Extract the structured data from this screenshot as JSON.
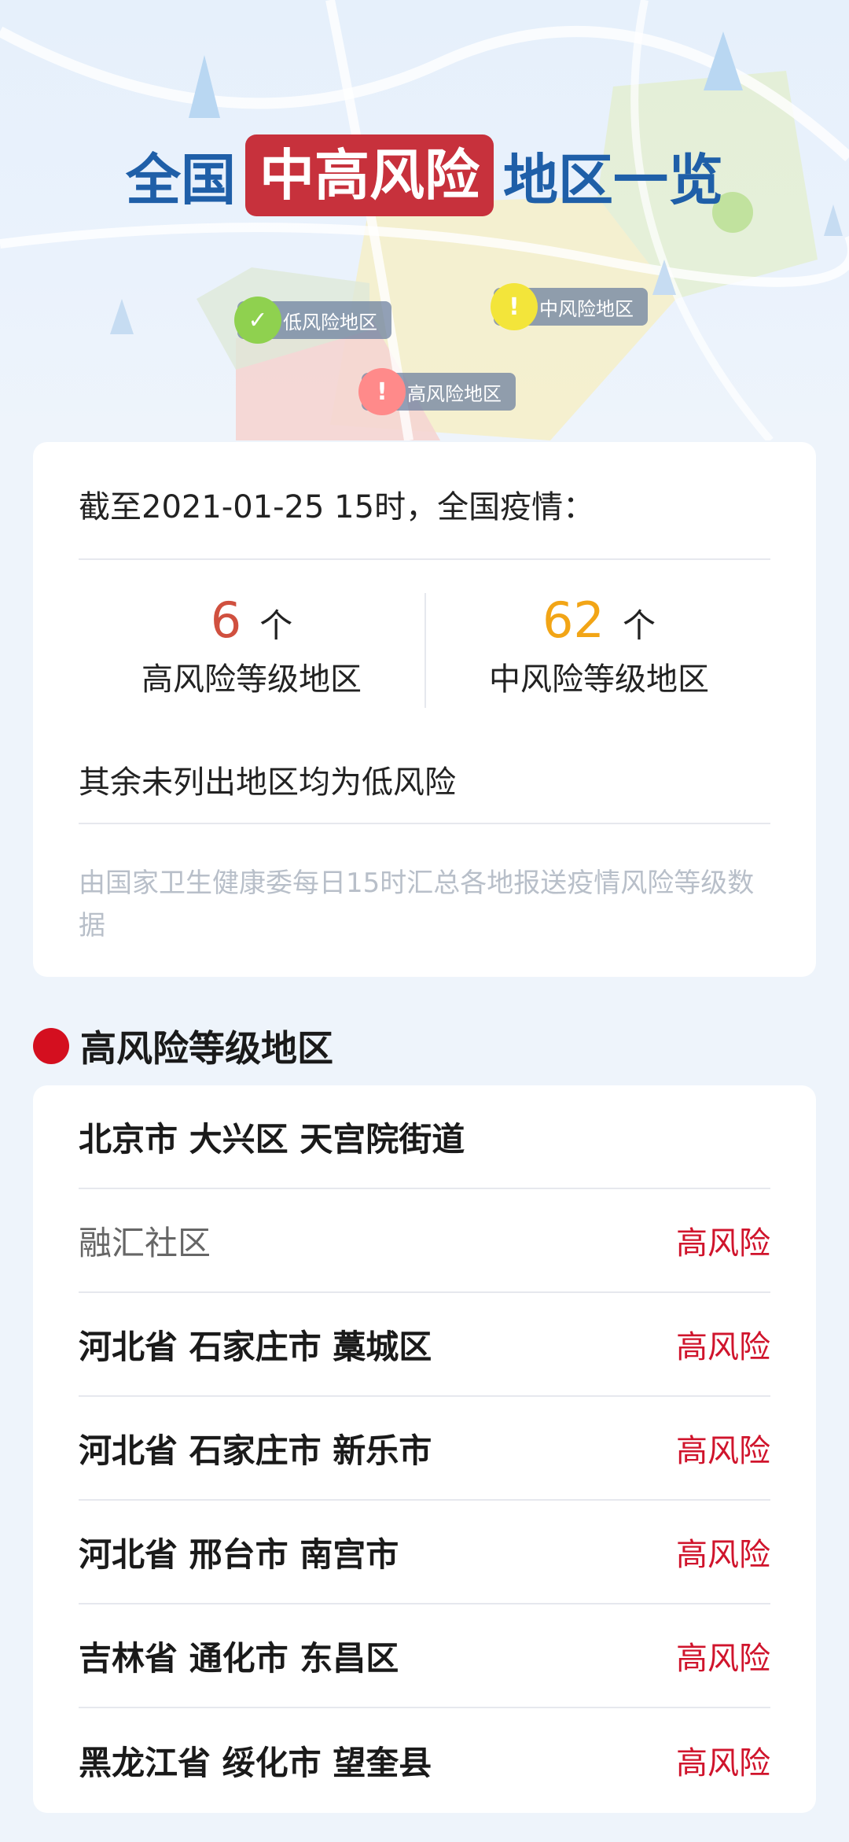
{
  "hero": {
    "title_prefix": "全国",
    "title_highlight": "中高风险",
    "title_suffix": "地区一览",
    "chips": {
      "low": "低风险地区",
      "mid": "中风险地区",
      "high": "高风险地区"
    }
  },
  "summary": {
    "as_of": "截至2021-01-25 15时，全国疫情：",
    "high": {
      "count": "6",
      "unit": "个",
      "label": "高风险等级地区"
    },
    "mid": {
      "count": "62",
      "unit": "个",
      "label": "中风险等级地区"
    },
    "rest_note": "其余未列出地区均为低风险",
    "source_note": "由国家卫生健康委每日15时汇总各地报送疫情风险等级数据"
  },
  "high_section": {
    "title": "高风险等级地区",
    "rows": [
      {
        "name": "北京市 大兴区 天宫院街道",
        "risk": ""
      },
      {
        "name": "融汇社区",
        "risk": "高风险"
      },
      {
        "name": "河北省 石家庄市 藁城区",
        "risk": "高风险"
      },
      {
        "name": "河北省 石家庄市 新乐市",
        "risk": "高风险"
      },
      {
        "name": "河北省 邢台市 南宫市",
        "risk": "高风险"
      },
      {
        "name": "吉林省 通化市 东昌区",
        "risk": "高风险"
      },
      {
        "name": "黑龙江省 绥化市 望奎县",
        "risk": "高风险"
      }
    ]
  },
  "colors": {
    "title_blue": "#1f5fa8",
    "highlight_red": "#c7313c",
    "high_count": "#d0503f",
    "mid_count": "#f2a516",
    "risk_red": "#d0142c",
    "low_dot": "#8fd14f",
    "mid_dot": "#f3e53a",
    "high_dot": "#ff8a8a"
  }
}
